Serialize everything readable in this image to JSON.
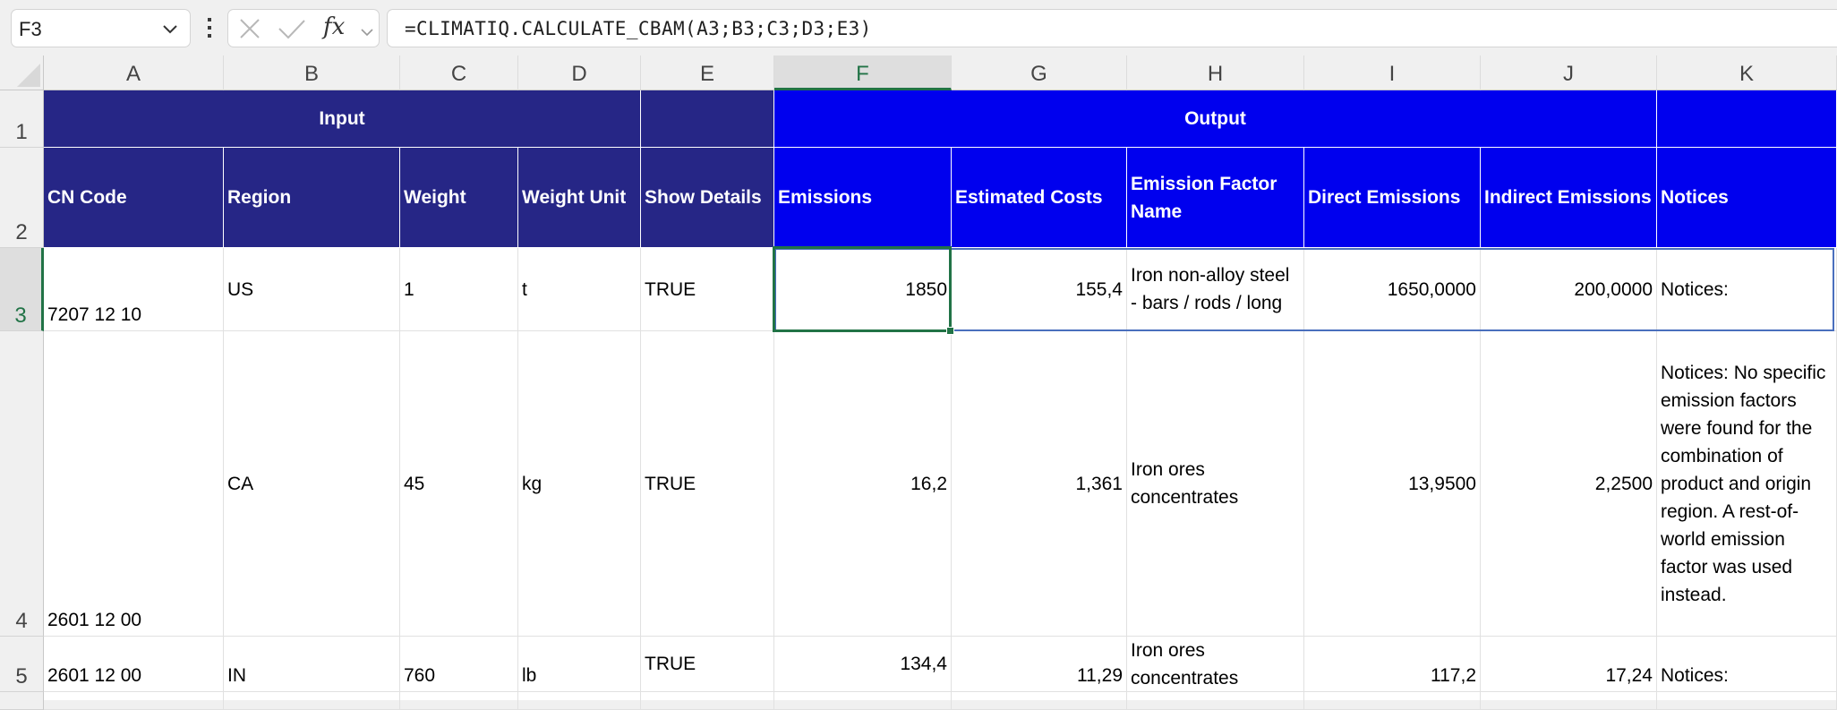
{
  "formula_bar": {
    "name_box": "F3",
    "formula": "=CLIMATIQ.CALCULATE_CBAM(A3;B3;C3;D3;E3)",
    "fx_label": "fx"
  },
  "columns": [
    "A",
    "B",
    "C",
    "D",
    "E",
    "F",
    "G",
    "H",
    "I",
    "J",
    "K"
  ],
  "selected_column": "F",
  "rows": [
    "1",
    "2",
    "3",
    "4",
    "5"
  ],
  "selected_row": "3",
  "colors": {
    "input_header": "#262686",
    "output_header": "#0000ee",
    "selection": "#217346",
    "spill_border": "#4a6fbd"
  },
  "row1": {
    "input_label": "Input",
    "output_label": "Output"
  },
  "headers": [
    "CN Code",
    "Region",
    "Weight",
    "Weight Unit",
    "Show Details",
    "Emissions",
    "Estimated Costs",
    "Emission Factor Name",
    "Direct Emissions",
    "Indirect Emissions",
    "Notices"
  ],
  "data_rows": [
    [
      "7207 12 10",
      "US",
      "1",
      "t",
      "TRUE",
      "1850",
      "155,4",
      "Iron non-alloy steel - bars / rods / long",
      "1650,0000",
      "200,0000",
      "Notices:"
    ],
    [
      "2601 12 00",
      "CA",
      "45",
      "kg",
      "TRUE",
      "16,2",
      "1,361",
      "Iron ores concentrates",
      "13,9500",
      "2,2500",
      "Notices: No specific emission factors were found for the combination of product and origin region. A rest-of-world emission factor was used instead."
    ],
    [
      "2601 12 00",
      "IN",
      "760",
      "lb",
      "TRUE",
      "134,4",
      "11,29",
      "Iron ores concentrates",
      "117,2",
      "17,24",
      "Notices:"
    ]
  ]
}
